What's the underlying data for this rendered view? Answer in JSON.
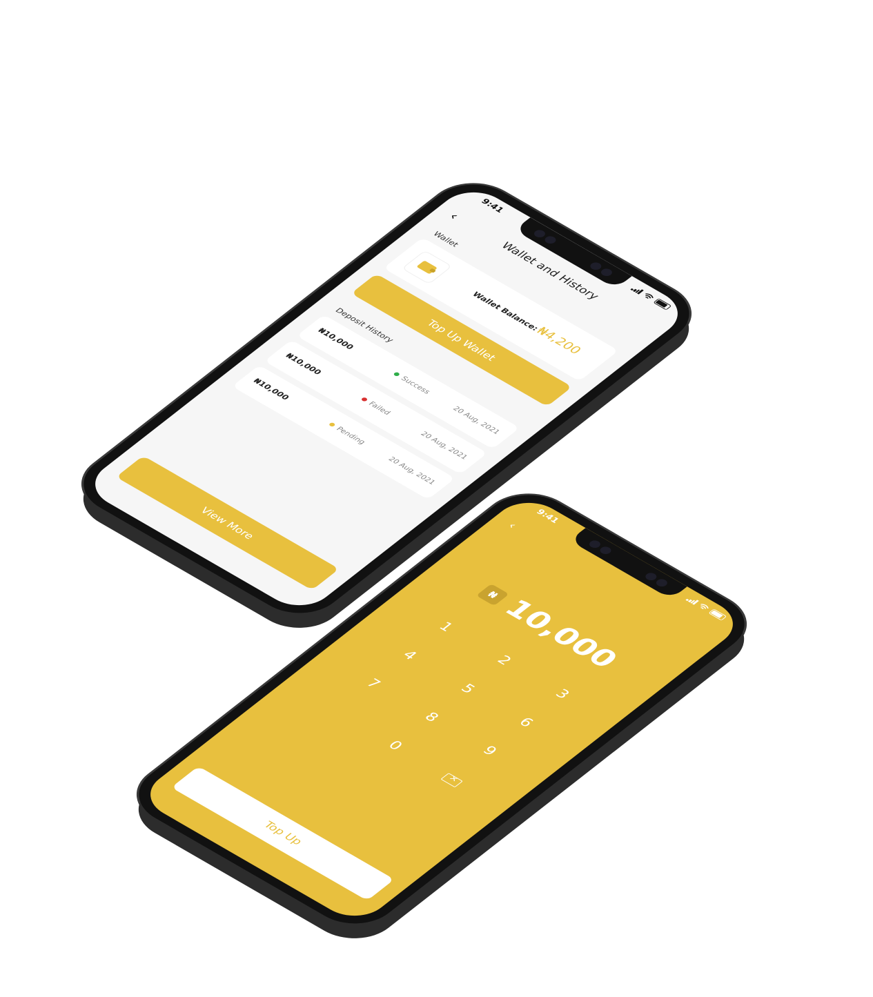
{
  "phone_wallet": {
    "status_time": "9:41",
    "title": "Wallet and History",
    "wallet_label": "Wallet",
    "balance_label": "Wallet Balance:",
    "balance_value": "₦4,200",
    "top_up_label": "Top Up Wallet",
    "history_label": "Deposit History",
    "history": [
      {
        "amount": "₦10,000",
        "status": "Success",
        "status_color": "#2fae4a",
        "date": "20 Aug, 2021"
      },
      {
        "amount": "₦10,000",
        "status": "Failed",
        "status_color": "#d83030",
        "date": "20 Aug, 2021"
      },
      {
        "amount": "₦10,000",
        "status": "Pending",
        "status_color": "#e8c03e",
        "date": "20 Aug, 2021"
      }
    ],
    "view_more_label": "View More"
  },
  "phone_topup": {
    "status_time": "9:41",
    "currency_symbol": "₦",
    "amount": "10,000",
    "keys": [
      "1",
      "2",
      "3",
      "4",
      "5",
      "6",
      "7",
      "8",
      "9",
      "0"
    ],
    "top_up_label": "Top Up"
  },
  "colors": {
    "accent": "#e8c03e",
    "background": "#ffffff",
    "screen_light": "#f6f6f6",
    "phone_frame": "#111111"
  }
}
